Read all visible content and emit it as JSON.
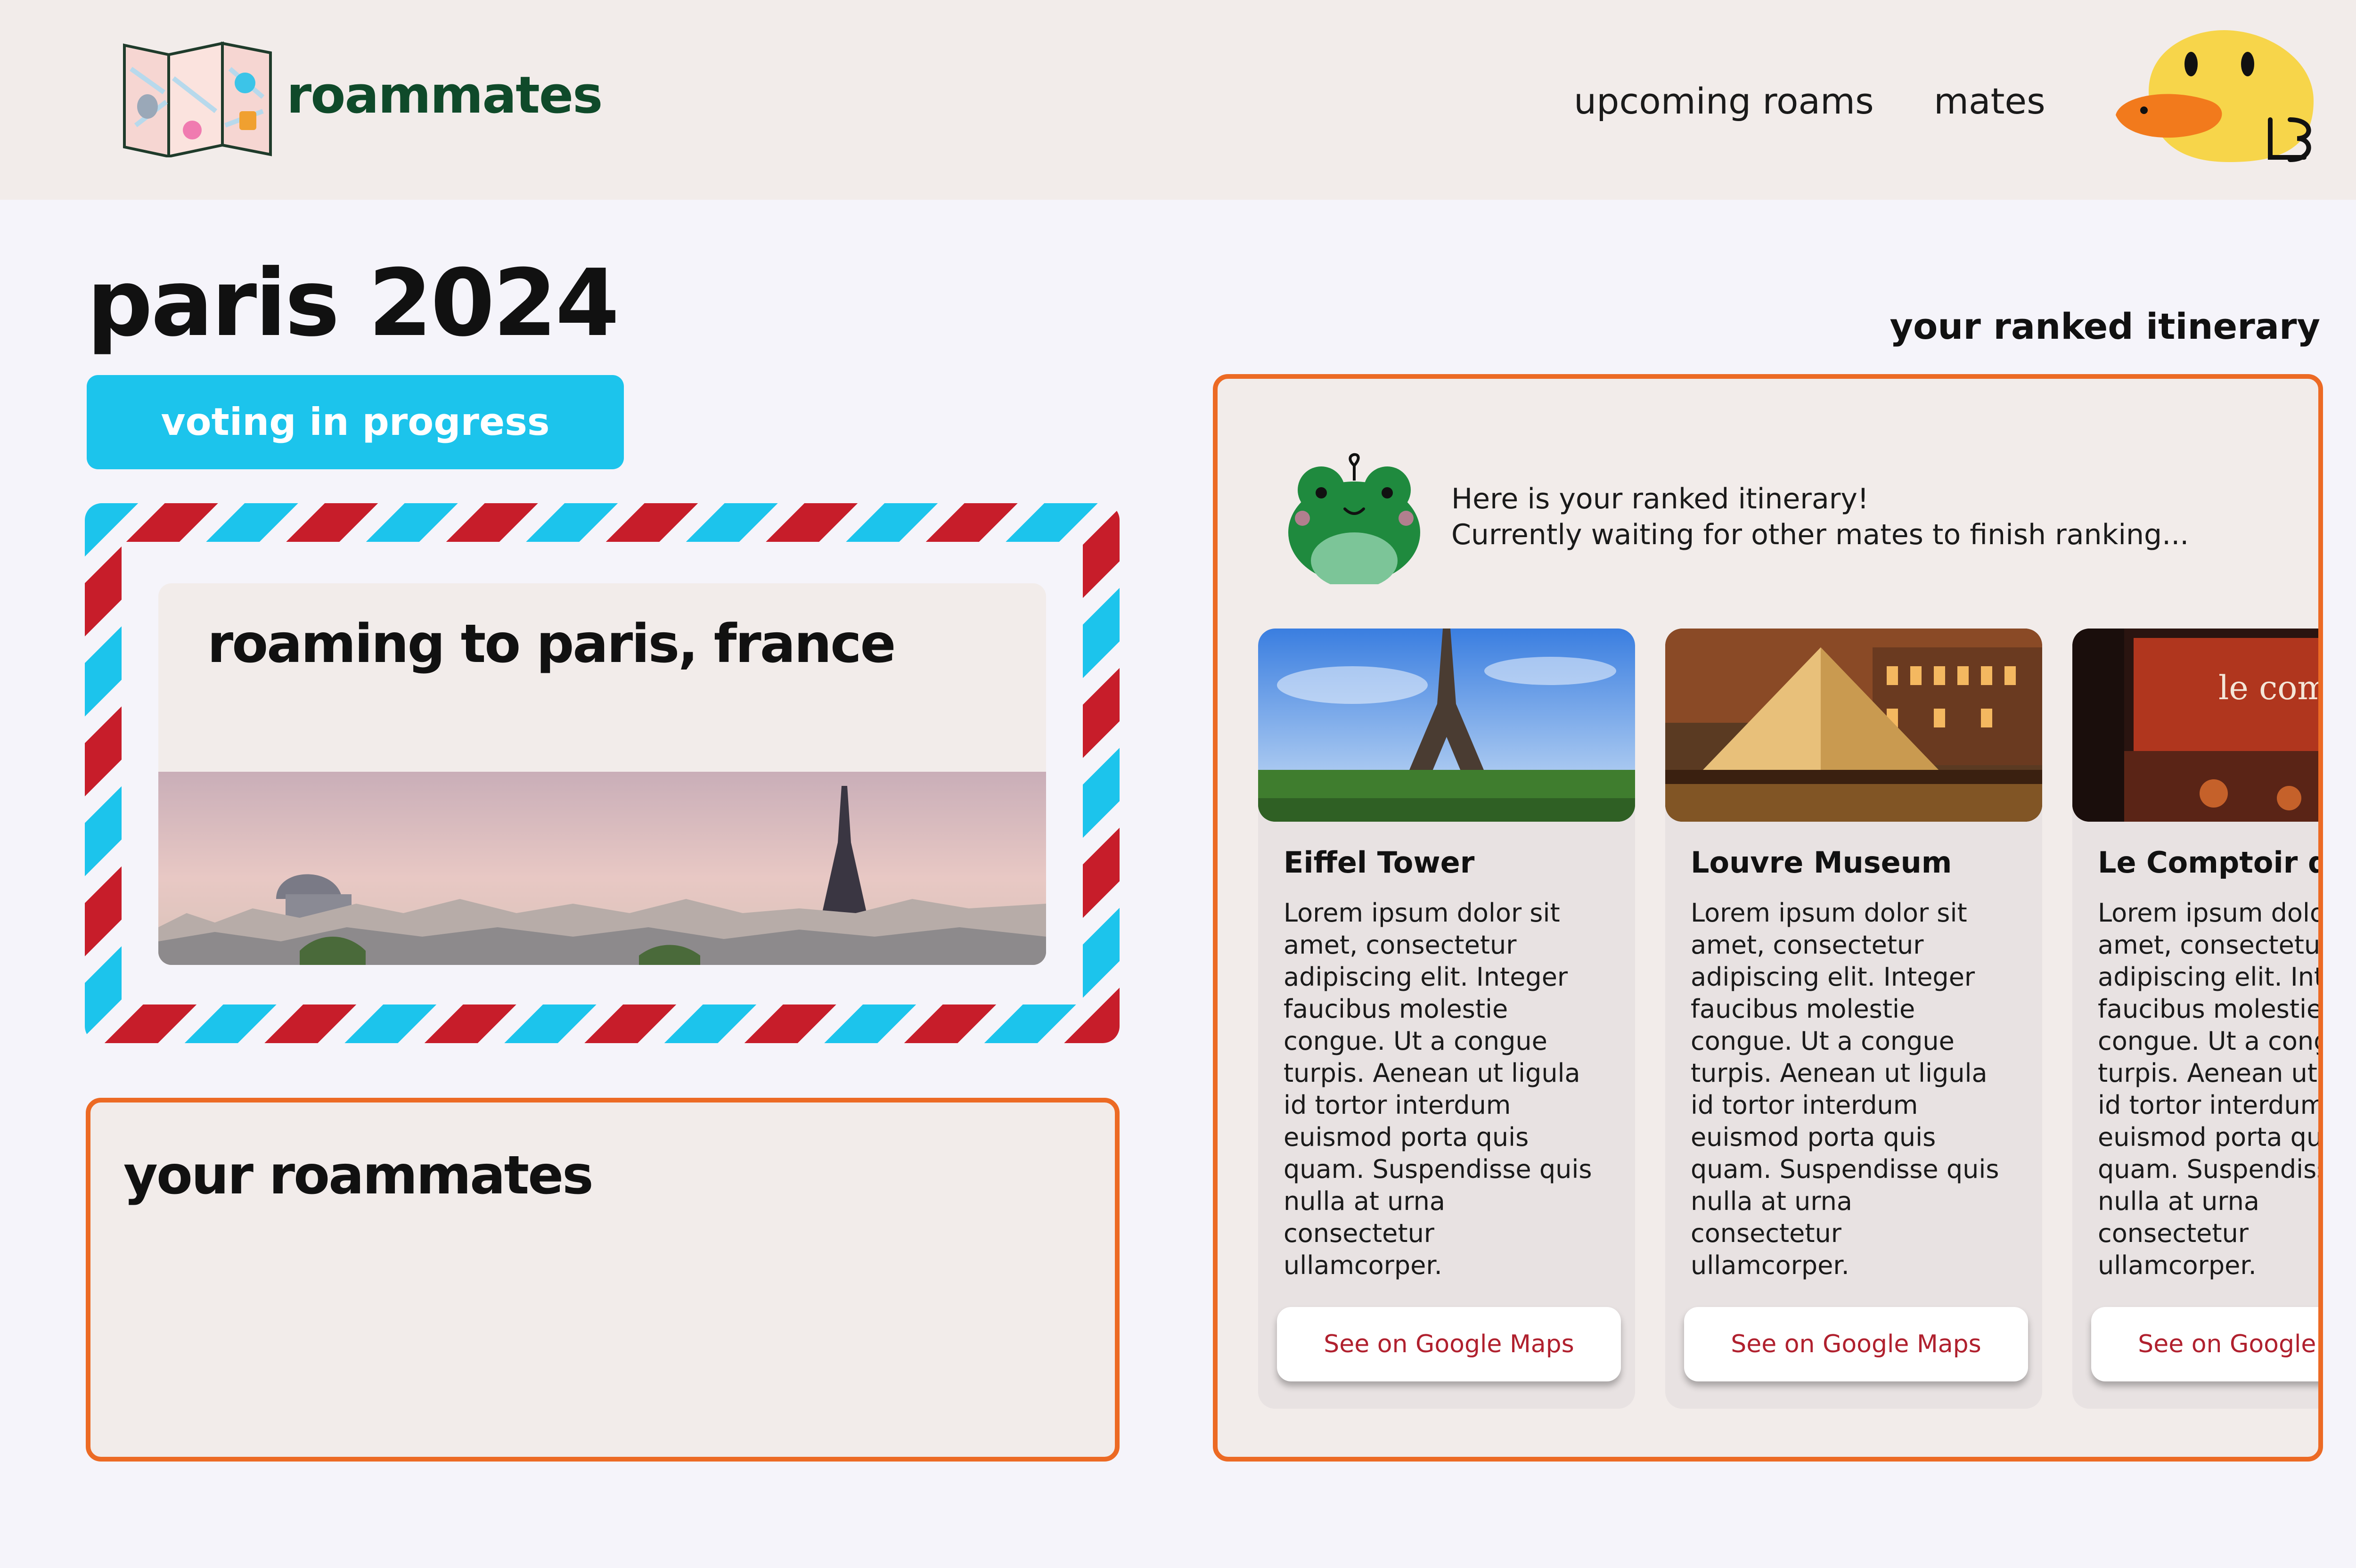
{
  "header": {
    "brand": "roammates",
    "nav": [
      "upcoming roams",
      "mates"
    ],
    "avatar_icon": "duck-avatar-icon",
    "logo_icon": "folded-map-logo-icon"
  },
  "page": {
    "title": "paris 2024",
    "status": "voting in progress",
    "itinerary_heading": "your ranked itinerary"
  },
  "destination": {
    "title": "roaming to paris, france",
    "image": "paris-skyline-image"
  },
  "roammates": {
    "title": "your roammates"
  },
  "itinerary": {
    "mascot_icon": "frog-mascot-icon",
    "message_line1": "Here is your ranked itinerary!",
    "message_line2": "Currently waiting for other mates to finish ranking...",
    "places": [
      {
        "name": "Eiffel Tower",
        "image": "eiffel-tower-photo",
        "description": "Lorem ipsum dolor sit amet, consectetur adipiscing elit. Integer faucibus molestie congue. Ut a congue turpis. Aenean ut ligula id tortor interdum euismod porta quis quam. Suspendisse quis nulla at urna consectetur ullamcorper.",
        "button": "See on Google Maps"
      },
      {
        "name": "Louvre Museum",
        "image": "louvre-museum-photo",
        "description": "Lorem ipsum dolor sit amet, consectetur adipiscing elit. Integer faucibus molestie congue. Ut a congue turpis. Aenean ut ligula id tortor interdum euismod porta quis quam. Suspendisse quis nulla at urna consectetur ullamcorper.",
        "button": "See on Google Maps"
      },
      {
        "name": "Le Comptoir du",
        "image": "le-comptoir-photo",
        "image_sign": "le compt",
        "description": "Lorem ipsum dolor sit amet, consectetur adipiscing elit. Integer faucibus molestie congue. Ut a congue turpis. Aenean ut ligula id tortor interdum euismod porta quis quam. Suspendisse quis nulla at urna consectetur ullamcorper.",
        "button": "See on Google Maps"
      }
    ]
  },
  "colors": {
    "accent_orange": "#ec6a24",
    "status_cyan": "#1cc4ec",
    "airmail_red": "#c71d2a",
    "brand_green": "#0f4a2a",
    "link_red": "#b0202e"
  }
}
